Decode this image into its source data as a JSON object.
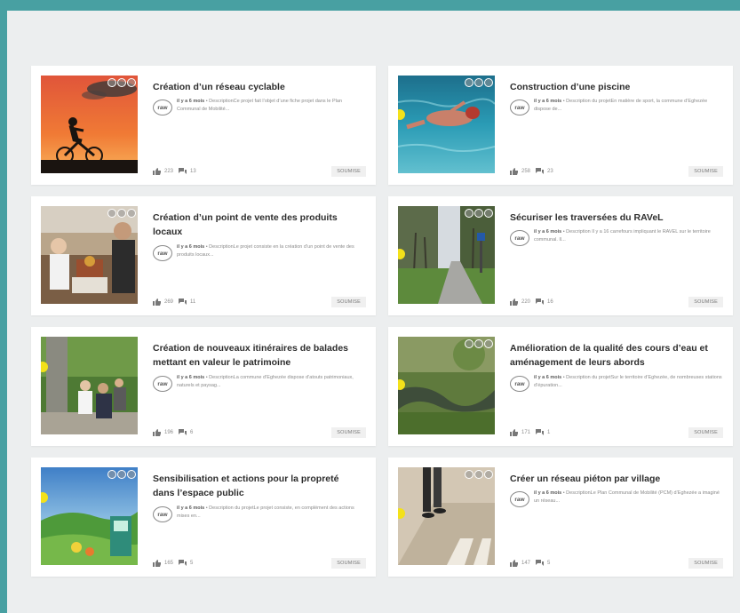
{
  "cards": [
    {
      "title": "Création d’un réseau cyclable",
      "age": "il y a 6 mois",
      "desc": "DescriptionCe projet fait l’objet d’une fiche projet dans le Plan Communal de Mobilité...",
      "likes": "223",
      "comments": "13",
      "status": "SOUMISE"
    },
    {
      "title": "Construction d’une piscine",
      "age": "il y a 6 mois",
      "desc": "Description du projetEn matière de sport, la commune d’Eghezée dispose de...",
      "likes": "258",
      "comments": "23",
      "status": "SOUMISE"
    },
    {
      "title": "Création d’un point de vente des produits locaux",
      "age": "il y a 6 mois",
      "desc": "DescriptionLe projet consiste en la création d’un point de vente des produits locaux...",
      "likes": "269",
      "comments": "11",
      "status": "SOUMISE"
    },
    {
      "title": "Sécuriser les traversées du RAVeL",
      "age": "il y a 6 mois",
      "desc": "Description Il y a 16 carrefours impliquant le RAVEL sur le territoire communal. Il...",
      "likes": "220",
      "comments": "16",
      "status": "SOUMISE"
    },
    {
      "title": "Création de nouveaux itinéraires de balades mettant en valeur le patrimoine",
      "age": "il y a 6 mois",
      "desc": "DescriptionLa commune d’Eghezée dispose d’atouts patrimoniaux, naturels et paysag...",
      "likes": "196",
      "comments": "6",
      "status": "SOUMISE"
    },
    {
      "title": "Amélioration de la qualité des cours d’eau et aménagement de leurs abords",
      "age": "il y a 6 mois",
      "desc": "Description du projetSur le territoire d’Eghezée, de nombreuses stations d’épuration...",
      "likes": "171",
      "comments": "1",
      "status": "SOUMISE"
    },
    {
      "title": "Sensibilisation et actions pour la propreté dans l’espace public",
      "age": "il y a 6 mois",
      "desc": "Description du projetLe projet consiste, en complément des actions mises en...",
      "likes": "165",
      "comments": "5",
      "status": "SOUMISE"
    },
    {
      "title": "Créer un réseau piéton par village",
      "age": "il y a 6 mois",
      "desc": "DescriptionLe Plan Communal de Mobilité (PCM) d’Eghezée a imaginé un réseau...",
      "likes": "147",
      "comments": "5",
      "status": "SOUMISE"
    }
  ],
  "logo_text": "raw",
  "colors": {
    "frame": "#48a0a2",
    "background": "#eceeef",
    "card": "#ffffff",
    "title": "#2d2d2d",
    "meta": "#8a8a8a",
    "accent_dot": "#f3e11a"
  }
}
